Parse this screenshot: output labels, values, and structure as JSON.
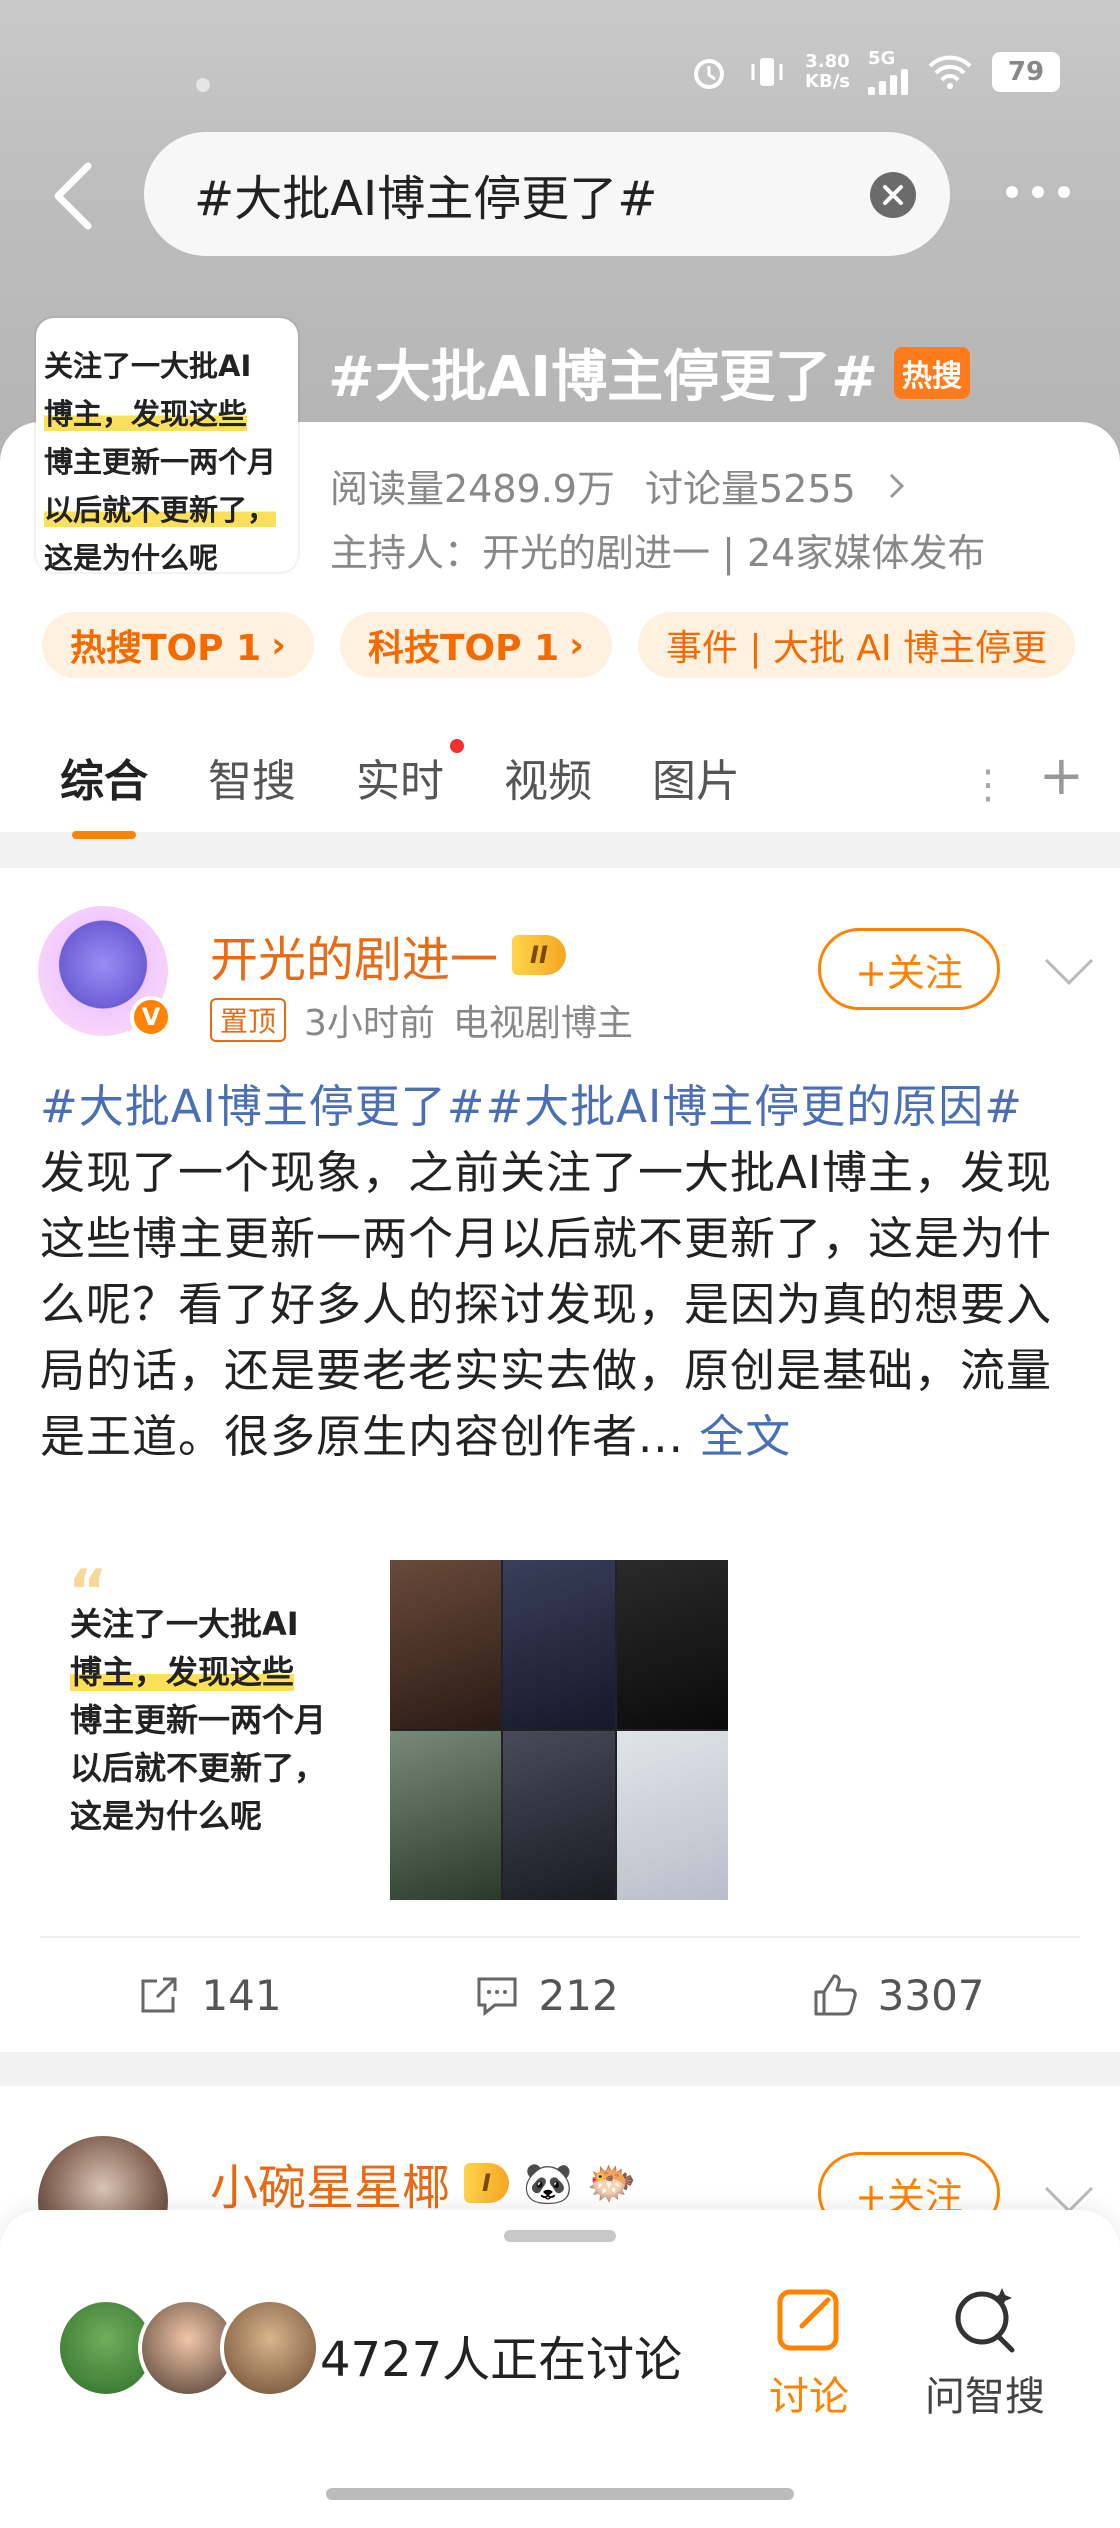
{
  "status_bar": {
    "net_speed_value": "3.80",
    "net_speed_unit": "KB/s",
    "network": "5G",
    "battery": "79"
  },
  "search": {
    "query": "#大批AI博主停更了#"
  },
  "topic": {
    "title": "#大批AI博主停更了#",
    "hot_badge": "热搜",
    "thumb_lines": [
      "关注了一大批AI",
      "博主，发现这些",
      "博主更新一两个月",
      "以后就不更新了，",
      "这是为什么呢"
    ],
    "reads": "阅读量2489.9万",
    "discussions": "讨论量5255",
    "host": "主持人：开光的剧进一 | 24家媒体发布",
    "chips": [
      {
        "label": "热搜TOP 1",
        "arrow": "›"
      },
      {
        "label": "科技TOP 1",
        "arrow": "›"
      },
      {
        "label": "事件 | 大批 AI 博主停更",
        "arrow": ""
      }
    ]
  },
  "tabs": [
    "综合",
    "智搜",
    "实时",
    "视频",
    "图片"
  ],
  "tab_more": "+",
  "post1": {
    "username": "开光的剧进一",
    "level_badge": "II",
    "pinned": "置顶",
    "time": "3小时前",
    "role": "电视剧博主",
    "follow_label": "+关注",
    "hashtags": "#大批AI博主停更了##大批AI博主停更的原因#",
    "body": "发现了一个现象，之前关注了一大批AI博主，发现这些博主更新一两个月以后就不更新了，这是为什么呢？看了好多人的探讨发现，是因为真的想要入局的话，还是要老老实实去做，原创是基础，流量是王道。很多原生内容创作者...",
    "full_text_link": "全文",
    "image1_lines": [
      "关注了一大批AI",
      "博主，发现这些",
      "博主更新一两个月",
      "以后就不更新了，",
      "这是为什么呢"
    ],
    "reposts": "141",
    "comments": "212",
    "likes": "3307"
  },
  "post2": {
    "username": "小碗星星椰",
    "follow_label": "+关注"
  },
  "bottom_bar": {
    "discussing": "4727人正在讨论",
    "discuss_label": "讨论",
    "ask_label": "问智搜"
  },
  "colors": {
    "accent": "#ff8200",
    "username": "#e86a14",
    "hashtag": "#4a6fb5"
  }
}
